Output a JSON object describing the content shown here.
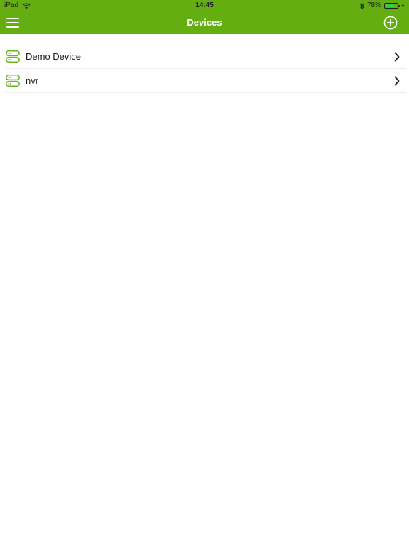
{
  "status": {
    "device": "iPad",
    "time": "14:45",
    "battery": "78%",
    "battery_level": 0.78
  },
  "header": {
    "title": "Devices",
    "menu_icon": "hamburger-menu-icon",
    "add_icon": "add-circle-icon"
  },
  "devices": [
    {
      "label": "Demo Device",
      "icon": "server-icon"
    },
    {
      "label": "nvr",
      "icon": "server-icon"
    }
  ],
  "colors": {
    "accent": "#64ae12",
    "icon_green": "#6cb41c",
    "battery_green": "#3ad23a"
  }
}
